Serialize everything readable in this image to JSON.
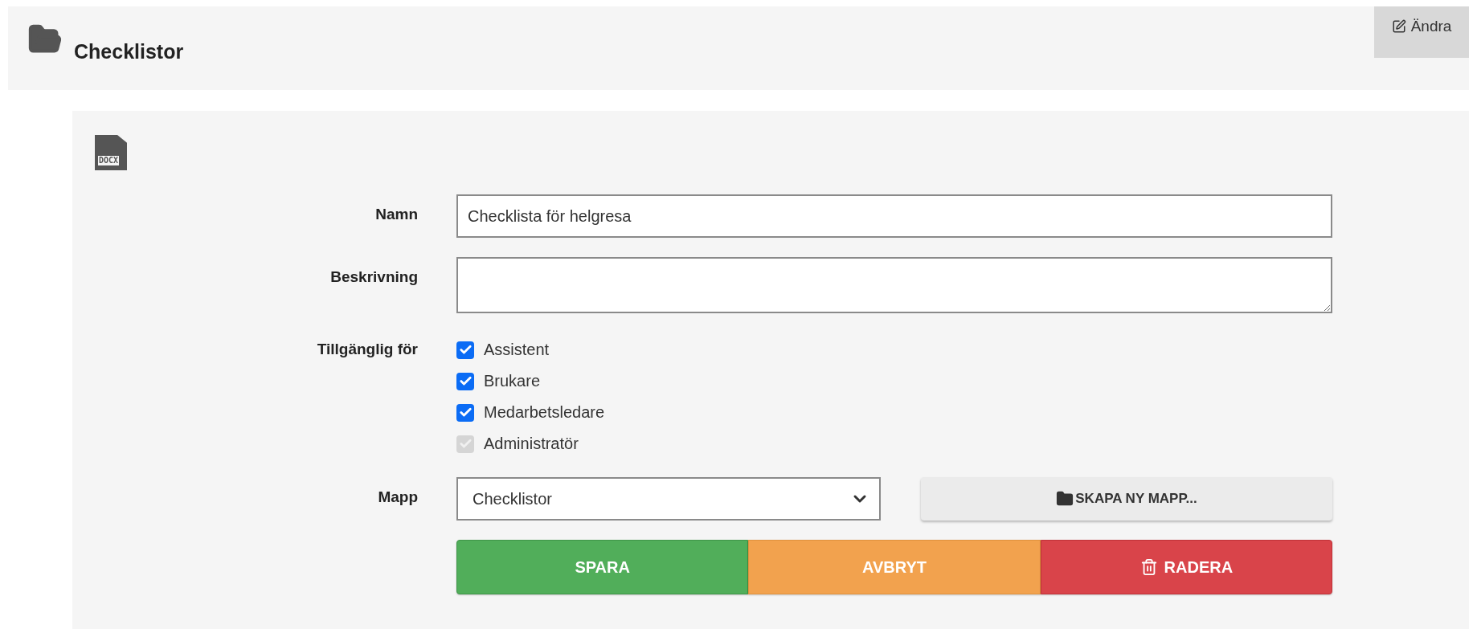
{
  "header": {
    "title": "Checklistor",
    "edit_button": "Ändra"
  },
  "document_icon_label": "DOCX",
  "form": {
    "name": {
      "label": "Namn",
      "value": "Checklista för helgresa"
    },
    "description": {
      "label": "Beskrivning"
    },
    "available_for": {
      "label": "Tillgänglig för",
      "options": [
        {
          "label": "Assistent",
          "checked": true,
          "disabled": false
        },
        {
          "label": "Brukare",
          "checked": true,
          "disabled": false
        },
        {
          "label": "Medarbetsledare",
          "checked": true,
          "disabled": false
        },
        {
          "label": "Administratör",
          "checked": true,
          "disabled": true
        }
      ]
    },
    "folder": {
      "label": "Mapp",
      "value": "Checklistor",
      "create_button": "SKAPA NY MAPP..."
    }
  },
  "actions": [
    {
      "kind": "save",
      "label": "SPARA"
    },
    {
      "kind": "cancel",
      "label": "AVBRYT"
    },
    {
      "kind": "delete",
      "label": "RADERA"
    }
  ]
}
